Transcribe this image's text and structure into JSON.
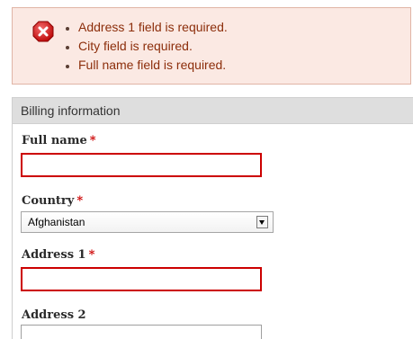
{
  "errors": {
    "messages": [
      "Address 1 field is required.",
      "City field is required.",
      "Full name field is required."
    ]
  },
  "billing": {
    "legend": "Billing information",
    "required_marker": "*",
    "full_name": {
      "label": "Full name",
      "value": ""
    },
    "country": {
      "label": "Country",
      "selected": "Afghanistan"
    },
    "address1": {
      "label": "Address 1",
      "value": ""
    },
    "address2": {
      "label": "Address 2",
      "value": ""
    }
  },
  "colors": {
    "error_bg": "#fbe9e3",
    "error_text": "#8c2e0b",
    "error_border": "#cc0000",
    "legend_bg": "#dedede"
  },
  "icons": {
    "error": "error-x-icon",
    "dropdown": "chevron-down-icon"
  }
}
